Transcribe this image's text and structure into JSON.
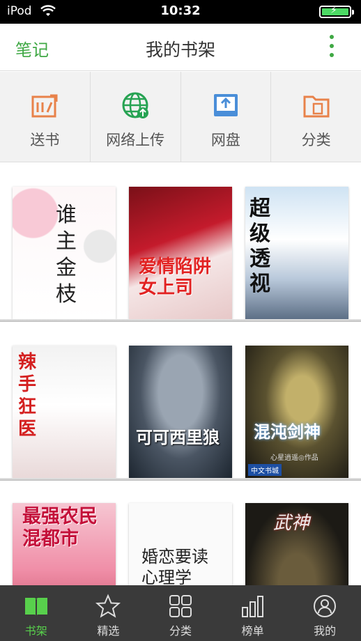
{
  "status_bar": {
    "carrier": "iPod",
    "time": "10:32"
  },
  "nav": {
    "left_label": "笔记",
    "title": "我的书架"
  },
  "actions": [
    {
      "label": "送书",
      "icon": "send-book-icon"
    },
    {
      "label": "网络上传",
      "icon": "web-upload-icon"
    },
    {
      "label": "网盘",
      "icon": "cloud-drive-icon"
    },
    {
      "label": "分类",
      "icon": "category-folder-icon"
    }
  ],
  "books": [
    {
      "title": "谁主金枝"
    },
    {
      "title": "爱情陷阱 女上司"
    },
    {
      "title": "超级透视"
    },
    {
      "title": "辣手狂医"
    },
    {
      "title": "可可西里狼"
    },
    {
      "title": "混沌剑神",
      "author": "心星逍遥◎作品",
      "badge": "中文书城"
    },
    {
      "title": "最强农民混都市"
    },
    {
      "title": "婚恋要读心理学"
    },
    {
      "title": "武神"
    }
  ],
  "tabs": [
    {
      "label": "书架",
      "icon": "bookshelf-icon",
      "active": true
    },
    {
      "label": "精选",
      "icon": "star-icon"
    },
    {
      "label": "分类",
      "icon": "grid-icon"
    },
    {
      "label": "榜单",
      "icon": "bar-chart-icon"
    },
    {
      "label": "我的",
      "icon": "user-icon"
    }
  ],
  "colors": {
    "accent": "#3fa844",
    "tab_active": "#58d04c",
    "tabbar_bg": "#3a3a3a"
  }
}
